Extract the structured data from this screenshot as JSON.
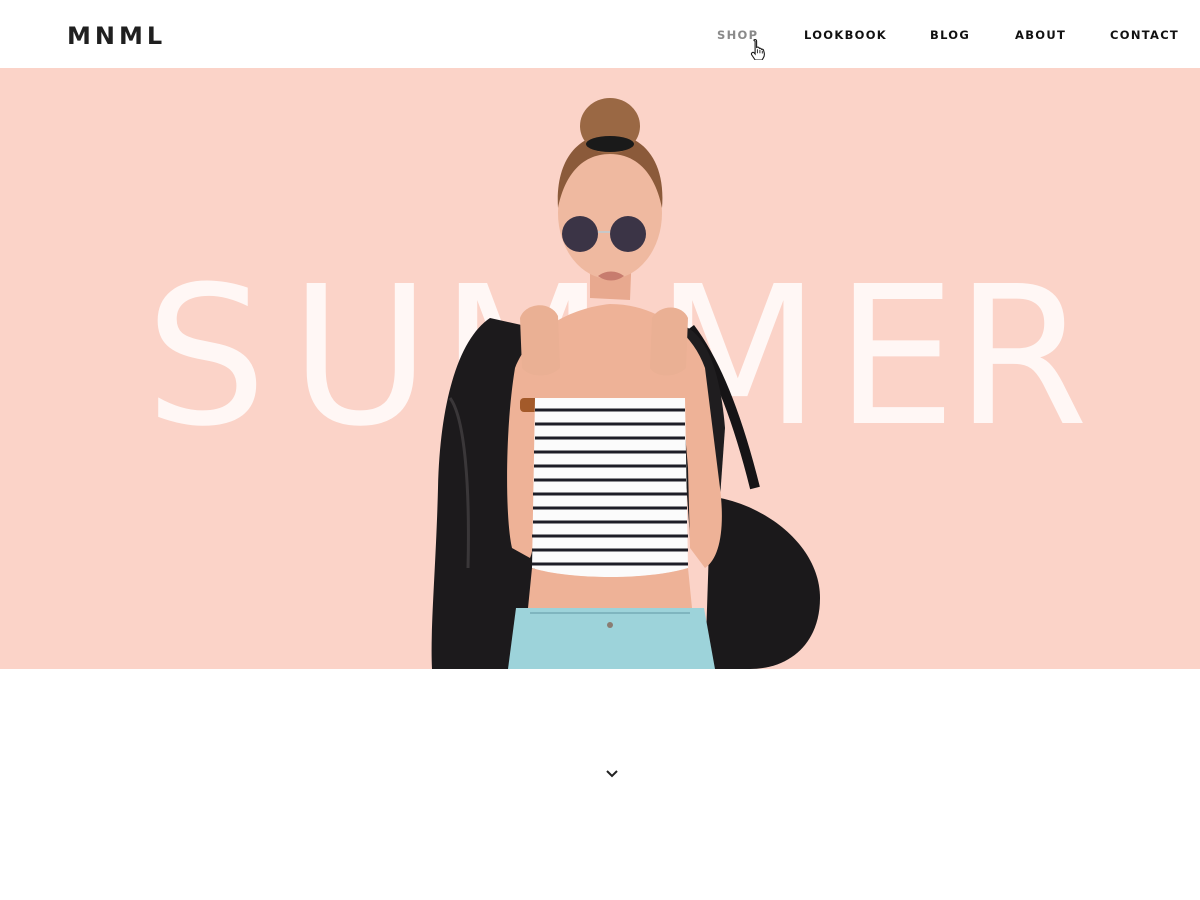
{
  "brand": {
    "logo_text": "MNML"
  },
  "nav": {
    "items": [
      {
        "label": "SHOP",
        "active": true
      },
      {
        "label": "LOOKBOOK",
        "active": false
      },
      {
        "label": "BLOG",
        "active": false
      },
      {
        "label": "ABOUT",
        "active": false
      },
      {
        "label": "CONTACT",
        "active": false
      }
    ]
  },
  "hero": {
    "headline_letters": [
      "S",
      "U",
      "M",
      "M",
      "E",
      "R"
    ],
    "background_color": "#fbd3c8",
    "image": "model-photo"
  },
  "scroll_indicator": {
    "icon": "chevron-down-icon"
  },
  "colors": {
    "text": "#111111",
    "nav_active": "#8a8a8a",
    "hero_bg": "#fbd3c8"
  }
}
